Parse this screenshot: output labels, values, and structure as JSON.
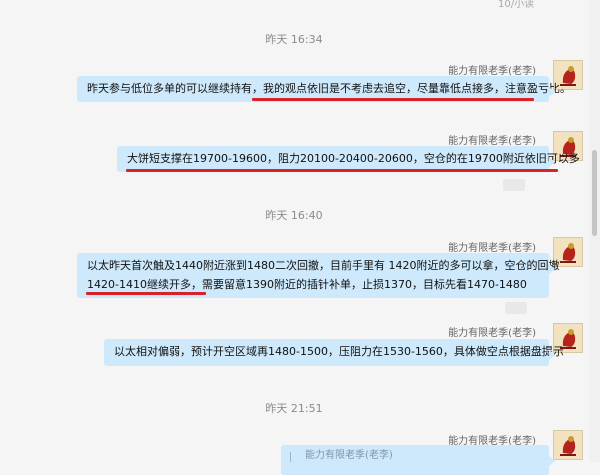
{
  "top_text": "10/小读",
  "timestamps": [
    "昨天 16:34",
    "昨天 16:40",
    "昨天 21:51"
  ],
  "messages": [
    {
      "sender": "能力有限老季(老李)",
      "text": "昨天参与低位多单的可以继续持有，我的观点依旧是不考虑去追空，尽量靠低点接多，注意盈亏比。"
    },
    {
      "sender": "能力有限老季(老李)",
      "text": "大饼短支撑在19700-19600，阻力20100-20400-20600，空仓的在19700附近依旧可以多"
    },
    {
      "sender": "能力有限老季(老李)",
      "text_line1": "以太昨天首次触及1440附近涨到1480二次回撤，目前手里有 1420附近的多可以拿，空仓的回撤",
      "text_line2": "1420-1410继续开多，需要留意1390附近的插针补单，止损1370，目标先看1470-1480"
    },
    {
      "sender": "能力有限老季(老李)",
      "text": "以太相对偏弱，预计开空区域再1480-1500，压阻力在1530-1560，具体做空点根据盘提示"
    },
    {
      "sender": "能力有限老季(老李)",
      "text": "能力有限老季(老李)"
    }
  ],
  "colors": {
    "bubble": "#cde9fb",
    "underline": "#d8222a",
    "background": "#f5f5f5"
  },
  "avatar_icon": "scorpion-king-avatar-icon"
}
